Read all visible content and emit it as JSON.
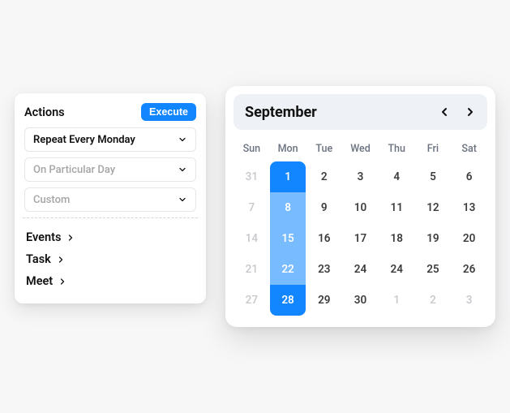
{
  "actions": {
    "title": "Actions",
    "execute_label": "Execute",
    "selects": [
      {
        "label": "Repeat Every Monday",
        "active": true
      },
      {
        "label": "On Particular Day",
        "active": false
      },
      {
        "label": "Custom",
        "active": false
      }
    ],
    "links": [
      {
        "label": "Events"
      },
      {
        "label": "Task"
      },
      {
        "label": "Meet"
      }
    ]
  },
  "calendar": {
    "month_label": "September",
    "dow": [
      "Sun",
      "Mon",
      "Tue",
      "Wed",
      "Thu",
      "Fri",
      "Sat"
    ],
    "cells": [
      {
        "n": "31",
        "other": true
      },
      {
        "n": "1",
        "sel": true,
        "range": true,
        "first": true
      },
      {
        "n": "2"
      },
      {
        "n": "3"
      },
      {
        "n": "4"
      },
      {
        "n": "5"
      },
      {
        "n": "6"
      },
      {
        "n": "7",
        "other": true
      },
      {
        "n": "8",
        "range": true
      },
      {
        "n": "9"
      },
      {
        "n": "10"
      },
      {
        "n": "11"
      },
      {
        "n": "12"
      },
      {
        "n": "13"
      },
      {
        "n": "14",
        "other": true
      },
      {
        "n": "15",
        "range": true
      },
      {
        "n": "16"
      },
      {
        "n": "17"
      },
      {
        "n": "18"
      },
      {
        "n": "19"
      },
      {
        "n": "20"
      },
      {
        "n": "21",
        "other": true
      },
      {
        "n": "22",
        "range": true
      },
      {
        "n": "23"
      },
      {
        "n": "24"
      },
      {
        "n": "24"
      },
      {
        "n": "25"
      },
      {
        "n": "26"
      },
      {
        "n": "27",
        "other": true
      },
      {
        "n": "28",
        "sel": true,
        "range": true,
        "last": true
      },
      {
        "n": "29"
      },
      {
        "n": "30"
      },
      {
        "n": "1",
        "other": true
      },
      {
        "n": "2",
        "other": true
      },
      {
        "n": "3",
        "other": true
      }
    ]
  }
}
